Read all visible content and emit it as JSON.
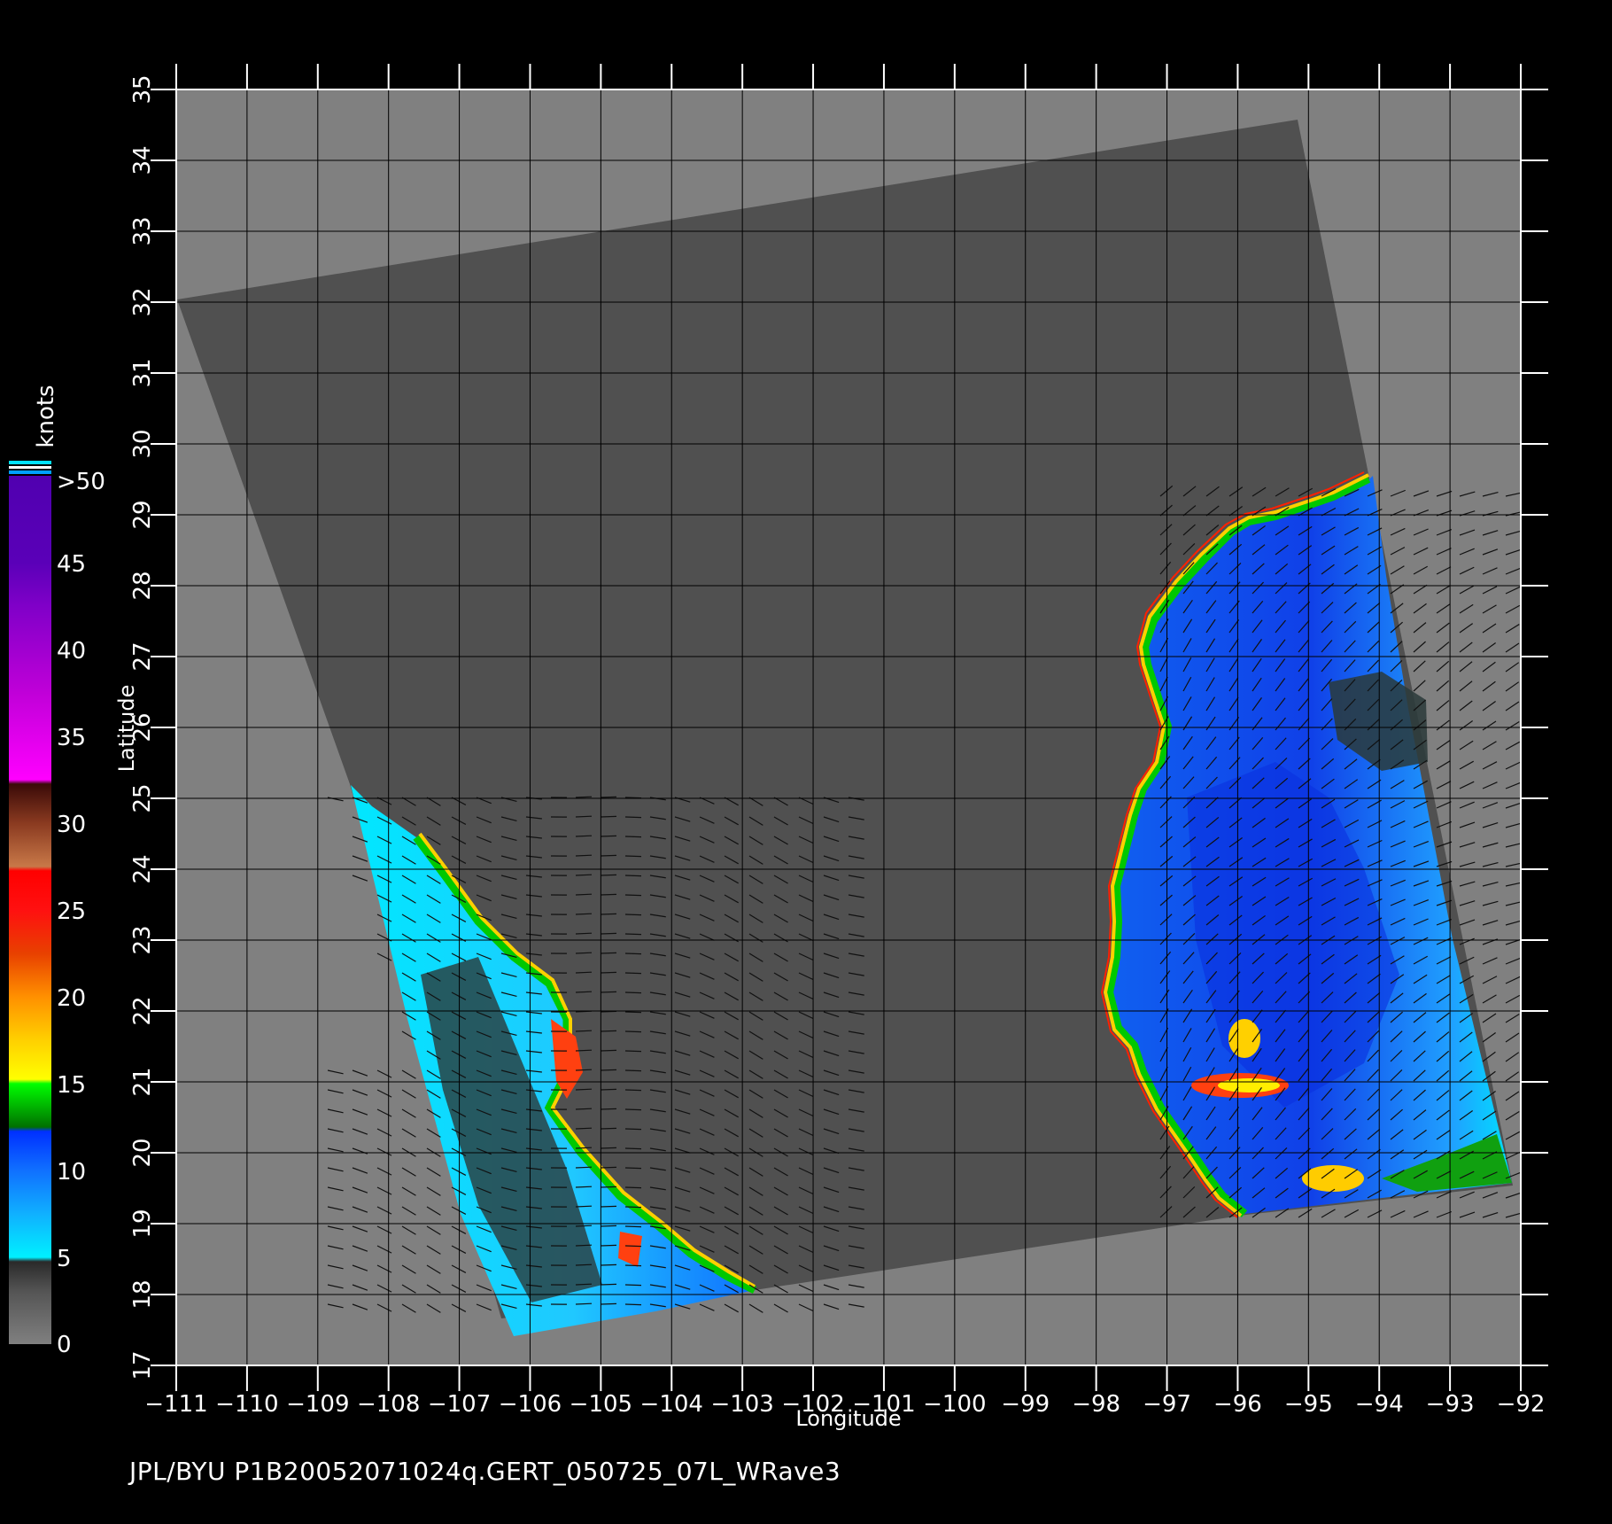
{
  "map": {
    "x_axis_label": "Longitude",
    "y_axis_label": "Latitude",
    "lon_ticks": [
      -111,
      -110,
      -109,
      -108,
      -107,
      -106,
      -105,
      -104,
      -103,
      -102,
      -101,
      -100,
      -99,
      -98,
      -97,
      -96,
      -95,
      -94,
      -93,
      -92
    ],
    "lat_ticks": [
      17,
      18,
      19,
      20,
      21,
      22,
      23,
      24,
      25,
      26,
      27,
      28,
      29,
      30,
      31,
      32,
      33,
      34,
      35
    ],
    "lon_range": [
      -111,
      -92
    ],
    "lat_range": [
      17,
      35
    ],
    "colors": {
      "land": "#808080",
      "swath": "#505050",
      "grid": "#000000"
    }
  },
  "colorbar": {
    "unit_label": "knots",
    "labels": [
      "0",
      "5",
      "10",
      "15",
      "20",
      "25",
      "30",
      "35",
      "40",
      "45",
      ">50"
    ],
    "colors": [
      "#777777",
      "#3a3a3a",
      "#00e8ff",
      "#1080ff",
      "#0030ff",
      "#00c800",
      "#108010",
      "#ffee00",
      "#ffaa00",
      "#ff6a10",
      "#e83a00",
      "#ff1010",
      "#ff0000",
      "#c87040",
      "#4a1008",
      "#ff00ff",
      "#c000d0",
      "#6a00c8"
    ]
  },
  "footer": {
    "text": "JPL/BYU  P1B20052071024q.GERT_050725_07L_WRave3"
  }
}
